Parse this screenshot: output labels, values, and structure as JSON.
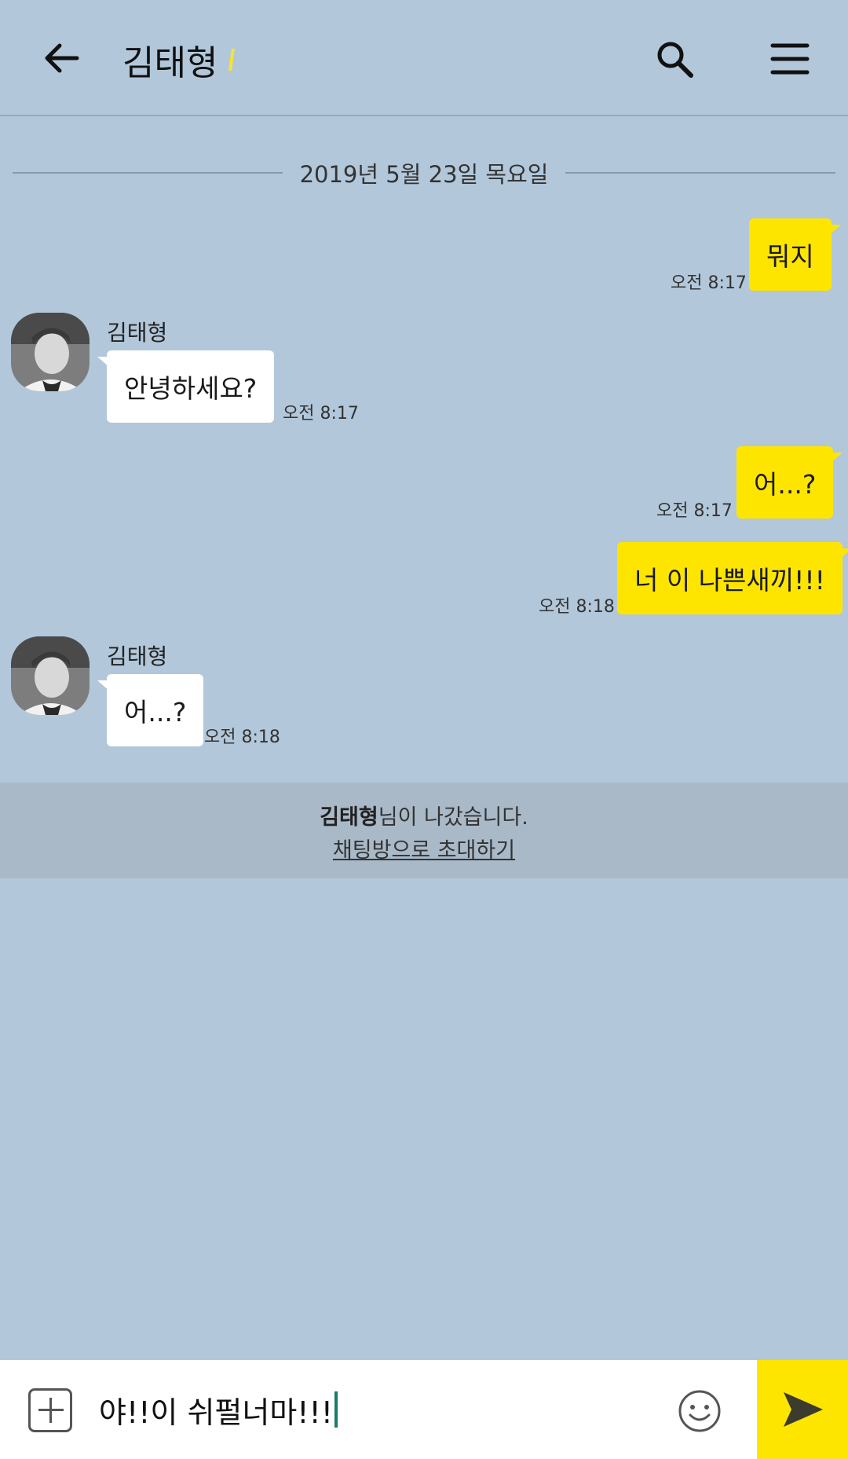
{
  "header": {
    "title": "김태형"
  },
  "date_divider": "2019년 5월 23일 목요일",
  "messages": [
    {
      "from": "me",
      "text": "뭐지",
      "time": "오전 8:17"
    },
    {
      "from": "them",
      "sender": "김태형",
      "text": "안녕하세요?",
      "time": "오전 8:17"
    },
    {
      "from": "me",
      "text": "어...?",
      "time": "오전 8:17"
    },
    {
      "from": "me",
      "text": "너 이 나쁜새끼!!!",
      "time": "오전 8:18"
    },
    {
      "from": "them",
      "sender": "김태형",
      "text": "어...?",
      "time": "오전 8:18"
    }
  ],
  "notice": {
    "name": "김태형",
    "suffix": "님이 나갔습니다.",
    "invite": "채팅방으로 초대하기"
  },
  "input": {
    "value": "야!!이 쉬펄너마!!!"
  },
  "colors": {
    "background": "#b2c7da",
    "my_bubble": "#fee500",
    "their_bubble": "#ffffff",
    "send_button": "#fee500"
  },
  "icons": [
    "back-arrow-icon",
    "search-icon",
    "menu-icon",
    "plus-icon",
    "emoji-icon",
    "send-icon"
  ]
}
